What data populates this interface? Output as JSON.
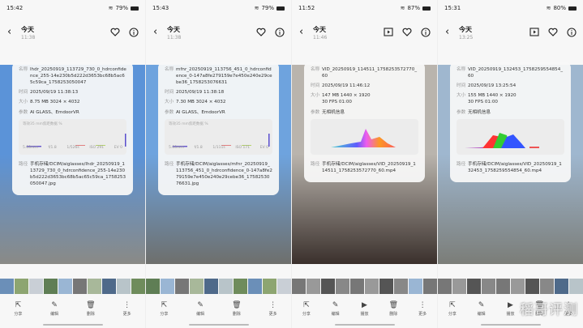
{
  "field_labels": {
    "name": "名称",
    "time": "时间",
    "size": "大小",
    "params": "参数",
    "path": "路径"
  },
  "histogram_caption": "等效35 mm焦距数据 %",
  "actions": {
    "share": "分享",
    "edit": "编辑",
    "play": "播放",
    "delete": "删除",
    "more": "更多"
  },
  "watermark": "稻哥评测",
  "panels": [
    {
      "clock": "15:42",
      "battery": "79%",
      "title": "今天",
      "time": "11:38",
      "is_video": false,
      "name": "lhdr_20250919_113729_730_0_hdrconfidence_255-14e230b5d222d3653bc68b5ac65c59ca_1758253050047",
      "datetime": "2025/09/19 11:38:13",
      "size": "8.75 MB   3024 × 4032",
      "size2": "",
      "params": "AI GLASS、EmdoorVR",
      "exif": [
        "5.00mm",
        "f/1.8",
        "1/526s",
        "ISO 291",
        "EV 0"
      ],
      "path": "手机存储/DCIM/aiglasses/lhdr_20250919_113729_730_0_hdrconfidence_255-14e230b5d222d3653bc68b5ac65c59ca_1758253050047.jpg",
      "colors": {
        "photo_top": "#5b93d8",
        "photo_bottom": "#8a8a86"
      }
    },
    {
      "clock": "15:43",
      "battery": "79%",
      "title": "今天",
      "time": "11:38",
      "is_video": false,
      "name": "mfnr_20250919_113756_451_0_hdrconfidence_0-147a8fe279159e7e450e240e29cebe36_1758253076631",
      "datetime": "2025/09/19 11:38:18",
      "size": "7.30 MB   3024 × 4032",
      "size2": "",
      "params": "AI GLASS、EmdoorVR",
      "exif": [
        "5.00mm",
        "f/1.8",
        "1/111s",
        "ISO 171",
        "EV 0"
      ],
      "path": "手机存储/DCIM/aiglasses/mfnr_20250919_113756_451_0_hdrconfidence_0-147a8fe279159e7e450e240e29cebe36_1758253076631.jpg",
      "colors": {
        "photo_top": "#6ea3de",
        "photo_bottom": "#6e6f6c"
      }
    },
    {
      "clock": "11:52",
      "battery": "87%",
      "title": "今天",
      "time": "11:46",
      "is_video": true,
      "name": "VID_20250919_114511_1758253572770_60",
      "datetime": "2025/09/19 11:46:12",
      "size": "147 MB   1440 × 1920",
      "size2": "30 FPS   01:00",
      "params": "无相机信息",
      "exif": [],
      "path": "手机存储/DCIM/aiglasses/VID_20250919_114511_1758253572770_60.mp4",
      "colors": {
        "photo_top": "#b9b4ad",
        "photo_bottom": "#3a302c"
      }
    },
    {
      "clock": "15:31",
      "battery": "80%",
      "title": "今天",
      "time": "13:25",
      "is_video": true,
      "name": "VID_20250919_132453_1758259554854_60",
      "datetime": "2025/09/19 13:25:54",
      "size": "155 MB   1440 × 1920",
      "size2": "30 FPS   01:00",
      "params": "无相机信息",
      "exif": [],
      "path": "手机存储/DCIM/aiglasses/VID_20250919_132453_1758259554854_60.mp4",
      "colors": {
        "photo_top": "#9fb7cf",
        "photo_bottom": "#7b7d78"
      }
    }
  ]
}
